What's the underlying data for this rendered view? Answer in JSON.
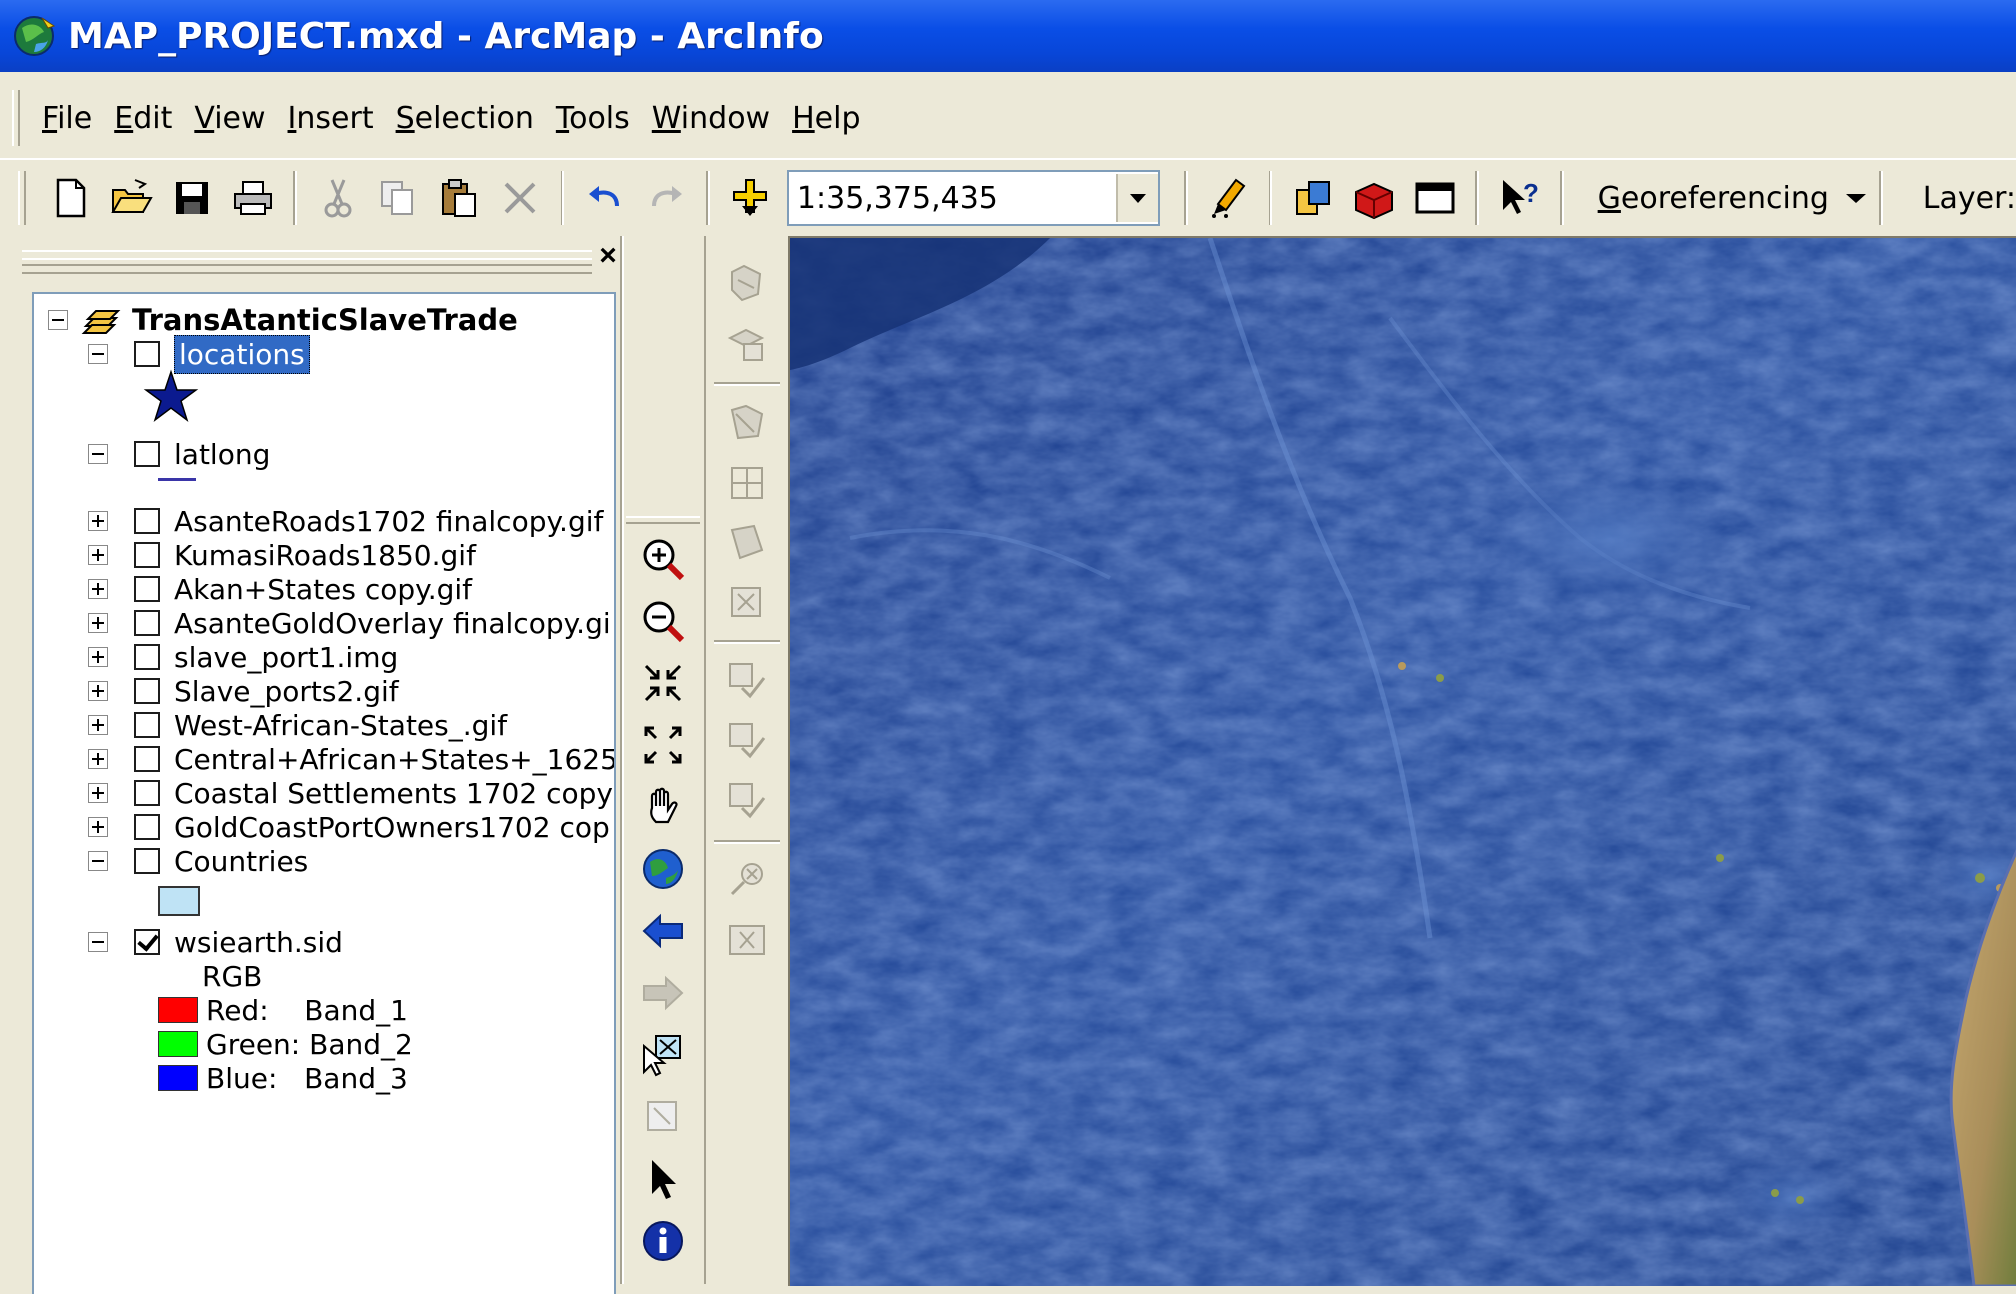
{
  "window": {
    "title": "MAP_PROJECT.mxd - ArcMap - ArcInfo"
  },
  "menu": [
    {
      "pre": "",
      "acc": "F",
      "post": "ile"
    },
    {
      "pre": "",
      "acc": "E",
      "post": "dit"
    },
    {
      "pre": "",
      "acc": "V",
      "post": "iew"
    },
    {
      "pre": "",
      "acc": "I",
      "post": "nsert"
    },
    {
      "pre": "",
      "acc": "S",
      "post": "election"
    },
    {
      "pre": "",
      "acc": "T",
      "post": "ools"
    },
    {
      "pre": "",
      "acc": "W",
      "post": "indow"
    },
    {
      "pre": "",
      "acc": "H",
      "post": "elp"
    }
  ],
  "toolbar": {
    "scale": "1:35,375,435",
    "georef_acc": "G",
    "georef_rest": "eoreferencing",
    "layer_label": "Layer:"
  },
  "toc": {
    "close": "×",
    "root": "TransAtanticSlaveTrade",
    "layers": {
      "locations": "locations",
      "latlong": "latlong",
      "l1": "AsanteRoads1702 finalcopy.gif",
      "l2": "KumasiRoads1850.gif",
      "l3": "Akan+States copy.gif",
      "l4": "AsanteGoldOverlay finalcopy.gi",
      "l5": "slave_port1.img",
      "l6": "Slave_ports2.gif",
      "l7": "West-African-States_.gif",
      "l8": "Central+African+States+_1625",
      "l9": "Coastal Settlements 1702 copy",
      "l10": "GoldCoastPortOwners1702 cop",
      "countries": "Countries",
      "wsiearth": "wsiearth.sid"
    },
    "rgb_title": "RGB",
    "bands": {
      "red": "Red:    Band_1",
      "green": "Green: Band_2",
      "blue": "Blue:   Band_3"
    }
  },
  "colors": {
    "title_bar": "#0a4ee6",
    "selection": "#316ac5",
    "ocean": "#2a4f9e",
    "land": "#b89a5e",
    "band_red": "#ff0000",
    "band_green": "#00ff00",
    "band_blue": "#0000ff",
    "countries_fill": "#bfe3f5"
  }
}
